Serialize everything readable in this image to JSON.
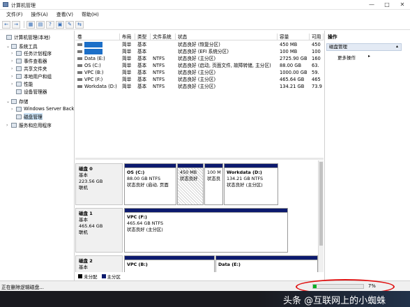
{
  "window": {
    "title": "计算机管理",
    "controls": [
      "—",
      "□",
      "✕"
    ]
  },
  "menu": [
    "文件(F)",
    "操作(A)",
    "查看(V)",
    "帮助(H)"
  ],
  "toolbar": {
    "buttons": [
      "←",
      "→",
      "▦",
      "▤",
      "?",
      "▣",
      "✎",
      "⇆"
    ]
  },
  "tree": {
    "items": [
      {
        "label": "计算机管理(本地)",
        "arrow": "",
        "indent": 0,
        "icon": "computer-icon"
      },
      {
        "label": "系统工具",
        "arrow": "⌄",
        "indent": 1,
        "icon": "tools-icon"
      },
      {
        "label": "任务计划程序",
        "arrow": "›",
        "indent": 2,
        "icon": "task-scheduler-icon"
      },
      {
        "label": "事件查看器",
        "arrow": "›",
        "indent": 2,
        "icon": "event-viewer-icon"
      },
      {
        "label": "共享文件夹",
        "arrow": "›",
        "indent": 2,
        "icon": "shared-folder-icon"
      },
      {
        "label": "本地用户和组",
        "arrow": "›",
        "indent": 2,
        "icon": "users-icon"
      },
      {
        "label": "性能",
        "arrow": "›",
        "indent": 2,
        "icon": "performance-icon"
      },
      {
        "label": "设备管理器",
        "arrow": "",
        "indent": 2,
        "icon": "device-manager-icon"
      },
      {
        "label": "存储",
        "arrow": "⌄",
        "indent": 1,
        "icon": "storage-icon"
      },
      {
        "label": "Windows Server Back",
        "arrow": "›",
        "indent": 2,
        "icon": "backup-icon"
      },
      {
        "label": "磁盘管理",
        "arrow": "",
        "indent": 2,
        "icon": "disk-management-icon",
        "selected": true
      },
      {
        "label": "服务和应用程序",
        "arrow": "›",
        "indent": 1,
        "icon": "services-icon"
      }
    ]
  },
  "volume_list": {
    "columns": [
      "卷",
      "布局",
      "类型",
      "文件系统",
      "状态",
      "容量",
      "可用"
    ],
    "rows": [
      {
        "volume": "",
        "layout": "简单",
        "type": "基本",
        "fs": "",
        "status": "状态良好 (恢复分区)",
        "capacity": "450 MB",
        "free": "450"
      },
      {
        "volume": "",
        "layout": "简单",
        "type": "基本",
        "fs": "",
        "status": "状态良好 (EFI 系统分区)",
        "capacity": "100 MB",
        "free": "100"
      },
      {
        "volume": "Data (E:)",
        "layout": "简单",
        "type": "基本",
        "fs": "NTFS",
        "status": "状态良好 (主分区)",
        "capacity": "2725.90 GB",
        "free": "160"
      },
      {
        "volume": "OS (C:)",
        "layout": "简单",
        "type": "基本",
        "fs": "NTFS",
        "status": "状态良好 (启动, 页面文件, 故障转储, 主分区)",
        "capacity": "88.00 GB",
        "free": "63."
      },
      {
        "volume": "VPC (B:)",
        "layout": "简单",
        "type": "基本",
        "fs": "NTFS",
        "status": "状态良好 (主分区)",
        "capacity": "1000.00 GB",
        "free": "59."
      },
      {
        "volume": "VPC (F:)",
        "layout": "简单",
        "type": "基本",
        "fs": "NTFS",
        "status": "状态良好 (主分区)",
        "capacity": "465.64 GB",
        "free": "465"
      },
      {
        "volume": "Workdata (D:)",
        "layout": "简单",
        "type": "基本",
        "fs": "NTFS",
        "status": "状态良好 (主分区)",
        "capacity": "134.21 GB",
        "free": "73.9"
      }
    ]
  },
  "disks": [
    {
      "name": "磁盘 0",
      "type": "基本",
      "size": "223.56 GB",
      "state": "联机",
      "partitions": [
        {
          "title": "OS (C:)",
          "size": "88.00 GB NTFS",
          "status": "状态良好 (启动, 页面",
          "style": "normal"
        },
        {
          "title": "",
          "size": "450 MB",
          "status": "状态良好",
          "style": "hatched"
        },
        {
          "title": "",
          "size": "100 M",
          "status": "状态良",
          "style": "normal"
        },
        {
          "title": "Workdata (D:)",
          "size": "134.21 GB NTFS",
          "status": "状态良好 (主分区)",
          "style": "normal"
        }
      ]
    },
    {
      "name": "磁盘 1",
      "type": "基本",
      "size": "465.64 GB",
      "state": "联机",
      "partitions": [
        {
          "title": "VPC (F:)",
          "size": "465.64 GB NTFS",
          "status": "状态良好 (主分区)",
          "style": "normal"
        }
      ]
    },
    {
      "name": "磁盘 2",
      "type": "基本",
      "size": "",
      "state": "",
      "partitions": [
        {
          "title": "VPC (B:)",
          "size": "",
          "status": "",
          "style": "normal"
        },
        {
          "title": "Data (E:)",
          "size": "",
          "status": "",
          "style": "normal"
        }
      ]
    }
  ],
  "legend": [
    {
      "label": "未分配",
      "color": "#000000"
    },
    {
      "label": "主分区",
      "color": "#0c1a6e"
    }
  ],
  "actions": {
    "title": "操作",
    "section": "磁盘管理",
    "more": "更多操作",
    "collapse_glyph": "▴",
    "more_glyph": "▸"
  },
  "status": {
    "text": "正在删除逻辑磁盘...",
    "progress_percent": 7,
    "progress_label": "7%"
  },
  "watermark": "头条 @互联网上的小蜘蛛"
}
